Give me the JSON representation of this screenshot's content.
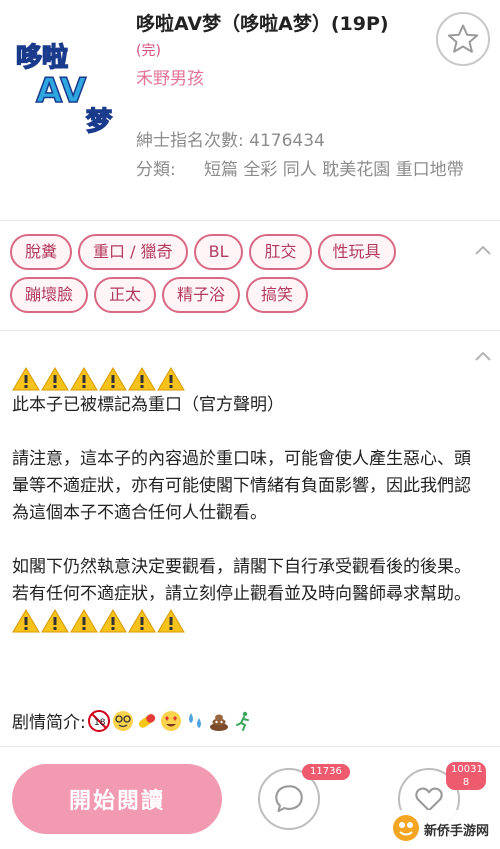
{
  "comic": {
    "title": "哆啦AV梦（哆啦A梦）(19P)",
    "status": "(完)",
    "author": "禾野男孩",
    "views_label": "紳士指名次數:",
    "views_value": "4176434",
    "category_label": "分類:",
    "category_value": "短篇 全彩 同人 耽美花園 重口地帶"
  },
  "tags": [
    "脫糞",
    "重口 / 獵奇",
    "BL",
    "肛交",
    "性玩具",
    "蹦壞臉",
    "正太",
    "精子浴",
    "搞笑"
  ],
  "description": {
    "line1": "此本子已被標記為重口（官方聲明）",
    "para2": "請注意，這本子的內容過於重口味，可能會使人產生惡心、頭暈等不適症狀，亦有可能使閣下情緒有負面影響，因此我們認為這個本子不適合任何人仕觀看。",
    "para3": "如閣下仍然執意決定要觀看，請閣下自行承受觀看後的後果。若有任何不適症狀，請立刻停止觀看並及時向醫師尋求幫助。"
  },
  "plot_label": "剧情简介:",
  "bottom": {
    "read_label": "開始閱讀",
    "comments_count": "11736",
    "likes_count": "10031 8"
  },
  "watermark": "新侨手游网",
  "icons": [
    "star-icon",
    "chevron-up-icon",
    "warning-icon",
    "comment-icon",
    "heart-icon"
  ],
  "colors": {
    "accent": "#f19ab2",
    "tag_border": "#d96884",
    "badge": "#ee5a6e",
    "warning": "#f6c21c"
  }
}
